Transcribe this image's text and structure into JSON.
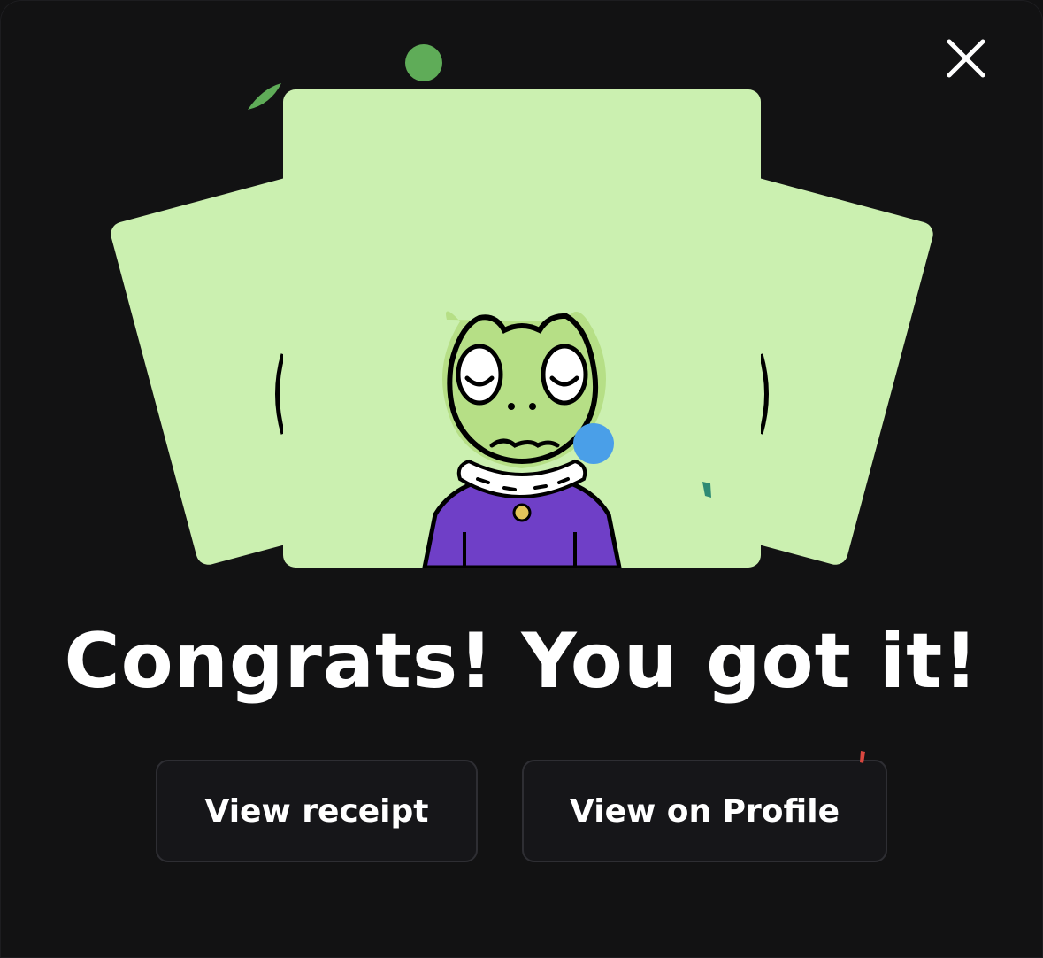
{
  "modal": {
    "headline": "Congrats! You got it!",
    "close_icon": "close-icon",
    "buttons": {
      "receipt_label": "View receipt",
      "profile_label": "View on Profile"
    }
  },
  "artwork": {
    "card_color": "#cbf0b0",
    "frog_skin": "#b6df86",
    "sweater": "#6f3fc7"
  },
  "colors": {
    "background": "#121213",
    "text": "#ffffff",
    "button_bg": "#161619",
    "button_border": "#2e2e33"
  }
}
